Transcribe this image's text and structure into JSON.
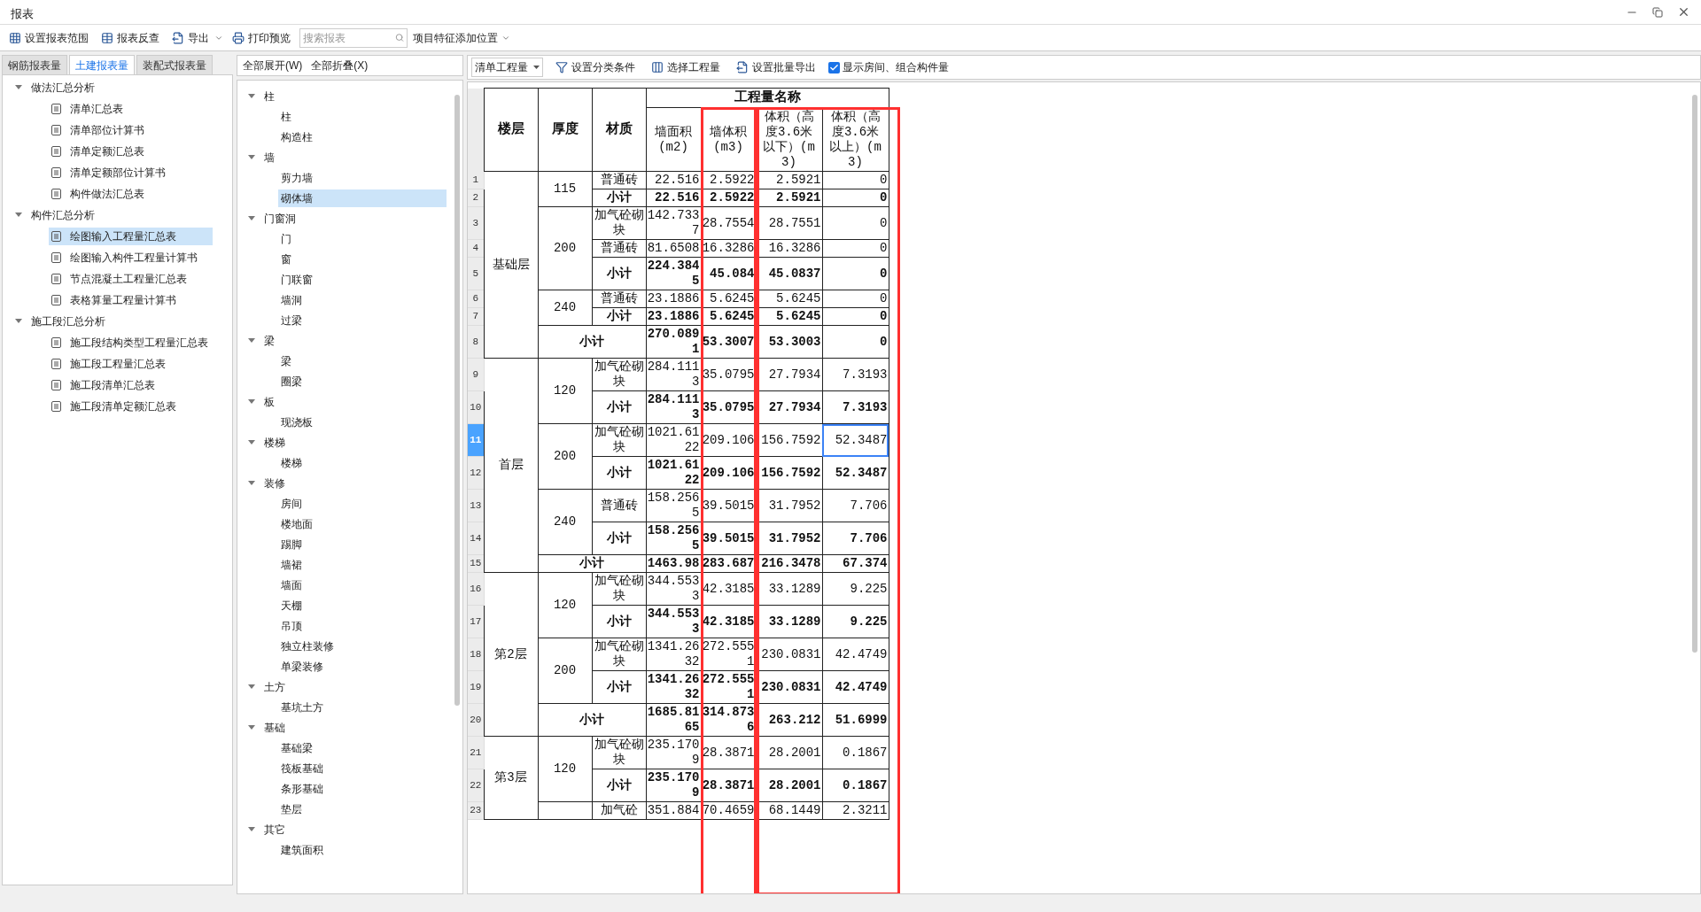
{
  "window": {
    "title": "报表"
  },
  "toolbar": {
    "buttons": [
      {
        "label": "设置报表范围",
        "kind": "range"
      },
      {
        "label": "报表反查",
        "kind": "lookup"
      },
      {
        "label": "导出",
        "kind": "export"
      },
      {
        "label": "打印预览",
        "kind": "print"
      }
    ],
    "search": {
      "placeholder": "搜索报表"
    },
    "position_menu": "项目特征添加位置"
  },
  "report_tabs": [
    {
      "label": "钢筋报表量",
      "selected": false
    },
    {
      "label": "土建报表量",
      "selected": true
    },
    {
      "label": "装配式报表量",
      "selected": false
    }
  ],
  "report_tree": [
    {
      "label": "做法汇总分析",
      "expanded": true,
      "children": [
        {
          "label": "清单汇总表",
          "selected": false
        },
        {
          "label": "清单部位计算书",
          "selected": false
        },
        {
          "label": "清单定额汇总表",
          "selected": false
        },
        {
          "label": "清单定额部位计算书",
          "selected": false
        },
        {
          "label": "构件做法汇总表",
          "selected": false
        }
      ]
    },
    {
      "label": "构件汇总分析",
      "expanded": true,
      "children": [
        {
          "label": "绘图输入工程量汇总表",
          "selected": true
        },
        {
          "label": "绘图输入构件工程量计算书",
          "selected": false
        },
        {
          "label": "节点混凝土工程量汇总表",
          "selected": false
        },
        {
          "label": "表格算量工程量计算书",
          "selected": false
        }
      ]
    },
    {
      "label": "施工段汇总分析",
      "expanded": true,
      "children": [
        {
          "label": "施工段结构类型工程量汇总表",
          "selected": false
        },
        {
          "label": "施工段工程量汇总表",
          "selected": false
        },
        {
          "label": "施工段清单汇总表",
          "selected": false
        },
        {
          "label": "施工段清单定额汇总表",
          "selected": false
        }
      ]
    }
  ],
  "component_actions": [
    "全部展开(W)",
    "全部折叠(X)"
  ],
  "component_tree": [
    {
      "label": "柱",
      "expanded": true,
      "children": [
        {
          "label": "柱",
          "selected": false
        },
        {
          "label": "构造柱",
          "selected": false
        }
      ]
    },
    {
      "label": "墙",
      "expanded": true,
      "children": [
        {
          "label": "剪力墙",
          "selected": false
        },
        {
          "label": "砌体墙",
          "selected": true
        }
      ]
    },
    {
      "label": "门窗洞",
      "expanded": true,
      "children": [
        {
          "label": "门",
          "selected": false
        },
        {
          "label": "窗",
          "selected": false
        },
        {
          "label": "门联窗",
          "selected": false
        },
        {
          "label": "墙洞",
          "selected": false
        },
        {
          "label": "过梁",
          "selected": false
        }
      ]
    },
    {
      "label": "梁",
      "expanded": true,
      "children": [
        {
          "label": "梁",
          "selected": false
        },
        {
          "label": "圈梁",
          "selected": false
        }
      ]
    },
    {
      "label": "板",
      "expanded": true,
      "children": [
        {
          "label": "现浇板",
          "selected": false
        }
      ]
    },
    {
      "label": "楼梯",
      "expanded": true,
      "children": [
        {
          "label": "楼梯",
          "selected": false
        }
      ]
    },
    {
      "label": "装修",
      "expanded": true,
      "children": [
        {
          "label": "房间",
          "selected": false
        },
        {
          "label": "楼地面",
          "selected": false
        },
        {
          "label": "踢脚",
          "selected": false
        },
        {
          "label": "墙裙",
          "selected": false
        },
        {
          "label": "墙面",
          "selected": false
        },
        {
          "label": "天棚",
          "selected": false
        },
        {
          "label": "吊顶",
          "selected": false
        },
        {
          "label": "独立柱装修",
          "selected": false
        },
        {
          "label": "单梁装修",
          "selected": false
        }
      ]
    },
    {
      "label": "土方",
      "expanded": true,
      "children": [
        {
          "label": "基坑土方",
          "selected": false
        }
      ]
    },
    {
      "label": "基础",
      "expanded": true,
      "children": [
        {
          "label": "基础梁",
          "selected": false
        },
        {
          "label": "筏板基础",
          "selected": false
        },
        {
          "label": "条形基础",
          "selected": false
        },
        {
          "label": "垫层",
          "selected": false
        }
      ]
    },
    {
      "label": "其它",
      "expanded": true,
      "children": [
        {
          "label": "建筑面积",
          "selected": false
        }
      ]
    }
  ],
  "report_toolbar": {
    "mode_select": "清单工程量",
    "buttons": [
      {
        "label": "设置分类条件",
        "kind": "filter"
      },
      {
        "label": "选择工程量",
        "kind": "grid"
      },
      {
        "label": "设置批量导出",
        "kind": "export"
      }
    ],
    "room_checkbox": {
      "label": "显示房间、组合构件量",
      "checked": true
    }
  },
  "table": {
    "columns": [
      "楼层",
      "厚度",
      "材质"
    ],
    "group_header": "工程量名称",
    "sub_columns": [
      "墙面积(m2)",
      "墙体积(m3)",
      "体积（高度3.6米以下）(m3)",
      "体积（高度3.6米以上）(m3)"
    ],
    "floors": [
      {
        "name": "基础层",
        "groups": [
          {
            "thickness": "115",
            "rows": [
              {
                "no": "1",
                "kind": "item",
                "material": "普通砖",
                "values": [
                  "22.516",
                  "2.5922",
                  "2.5921",
                  "0"
                ],
                "selected": false
              },
              {
                "no": "2",
                "kind": "subtotal",
                "material": "小计",
                "values": [
                  "22.516",
                  "2.5922",
                  "2.5921",
                  "0"
                ],
                "selected": false
              }
            ]
          },
          {
            "thickness": "200",
            "rows": [
              {
                "no": "3",
                "kind": "item",
                "material": "加气砼砌块",
                "values": [
                  "142.7337",
                  "28.7554",
                  "28.7551",
                  "0"
                ],
                "selected": false
              },
              {
                "no": "4",
                "kind": "item",
                "material": "普通砖",
                "values": [
                  "81.6508",
                  "16.3286",
                  "16.3286",
                  "0"
                ],
                "selected": false
              },
              {
                "no": "5",
                "kind": "subtotal",
                "material": "小计",
                "values": [
                  "224.3845",
                  "45.084",
                  "45.0837",
                  "0"
                ],
                "selected": false
              }
            ]
          },
          {
            "thickness": "240",
            "rows": [
              {
                "no": "6",
                "kind": "item",
                "material": "普通砖",
                "values": [
                  "23.1886",
                  "5.6245",
                  "5.6245",
                  "0"
                ],
                "selected": false
              },
              {
                "no": "7",
                "kind": "subtotal",
                "material": "小计",
                "values": [
                  "23.1886",
                  "5.6245",
                  "5.6245",
                  "0"
                ],
                "selected": false
              }
            ]
          }
        ],
        "subtotal": {
          "no": "8",
          "label": "小计",
          "values": [
            "270.0891",
            "53.3007",
            "53.3003",
            "0"
          ],
          "selected": false
        }
      },
      {
        "name": "首层",
        "groups": [
          {
            "thickness": "120",
            "rows": [
              {
                "no": "9",
                "kind": "item",
                "material": "加气砼砌块",
                "values": [
                  "284.1113",
                  "35.0795",
                  "27.7934",
                  "7.3193"
                ],
                "selected": false
              },
              {
                "no": "10",
                "kind": "subtotal",
                "material": "小计",
                "values": [
                  "284.1113",
                  "35.0795",
                  "27.7934",
                  "7.3193"
                ],
                "selected": false
              }
            ]
          },
          {
            "thickness": "200",
            "rows": [
              {
                "no": "11",
                "kind": "item",
                "material": "加气砼砌块",
                "values": [
                  "1021.6122",
                  "209.106",
                  "156.7592",
                  "52.3487"
                ],
                "selected": true
              },
              {
                "no": "12",
                "kind": "subtotal",
                "material": "小计",
                "values": [
                  "1021.6122",
                  "209.106",
                  "156.7592",
                  "52.3487"
                ],
                "selected": false
              }
            ]
          },
          {
            "thickness": "240",
            "rows": [
              {
                "no": "13",
                "kind": "item",
                "material": "普通砖",
                "values": [
                  "158.2565",
                  "39.5015",
                  "31.7952",
                  "7.706"
                ],
                "selected": false
              },
              {
                "no": "14",
                "kind": "subtotal",
                "material": "小计",
                "values": [
                  "158.2565",
                  "39.5015",
                  "31.7952",
                  "7.706"
                ],
                "selected": false
              }
            ]
          }
        ],
        "subtotal": {
          "no": "15",
          "label": "小计",
          "values": [
            "1463.98",
            "283.687",
            "216.3478",
            "67.374"
          ],
          "selected": false
        }
      },
      {
        "name": "第2层",
        "groups": [
          {
            "thickness": "120",
            "rows": [
              {
                "no": "16",
                "kind": "item",
                "material": "加气砼砌块",
                "values": [
                  "344.5533",
                  "42.3185",
                  "33.1289",
                  "9.225"
                ],
                "selected": false
              },
              {
                "no": "17",
                "kind": "subtotal",
                "material": "小计",
                "values": [
                  "344.5533",
                  "42.3185",
                  "33.1289",
                  "9.225"
                ],
                "selected": false
              }
            ]
          },
          {
            "thickness": "200",
            "rows": [
              {
                "no": "18",
                "kind": "item",
                "material": "加气砼砌块",
                "values": [
                  "1341.2632",
                  "272.5551",
                  "230.0831",
                  "42.4749"
                ],
                "selected": false
              },
              {
                "no": "19",
                "kind": "subtotal",
                "material": "小计",
                "values": [
                  "1341.2632",
                  "272.5551",
                  "230.0831",
                  "42.4749"
                ],
                "selected": false
              }
            ]
          }
        ],
        "subtotal": {
          "no": "20",
          "label": "小计",
          "values": [
            "1685.8165",
            "314.8736",
            "263.212",
            "51.6999"
          ],
          "selected": false
        }
      },
      {
        "name": "第3层",
        "groups": [
          {
            "thickness": "120",
            "rows": [
              {
                "no": "21",
                "kind": "item",
                "material": "加气砼砌块",
                "values": [
                  "235.1709",
                  "28.3871",
                  "28.2001",
                  "0.1867"
                ],
                "selected": false
              },
              {
                "no": "22",
                "kind": "subtotal",
                "material": "小计",
                "values": [
                  "235.1709",
                  "28.3871",
                  "28.2001",
                  "0.1867"
                ],
                "selected": false
              }
            ]
          },
          {
            "rows": [
              {
                "no": "23",
                "kind": "item",
                "material": "加气砼",
                "values": [
                  "351.884",
                  "70.4659",
                  "68.1449",
                  "2.3211"
                ],
                "selected": false
              }
            ]
          }
        ]
      }
    ]
  }
}
